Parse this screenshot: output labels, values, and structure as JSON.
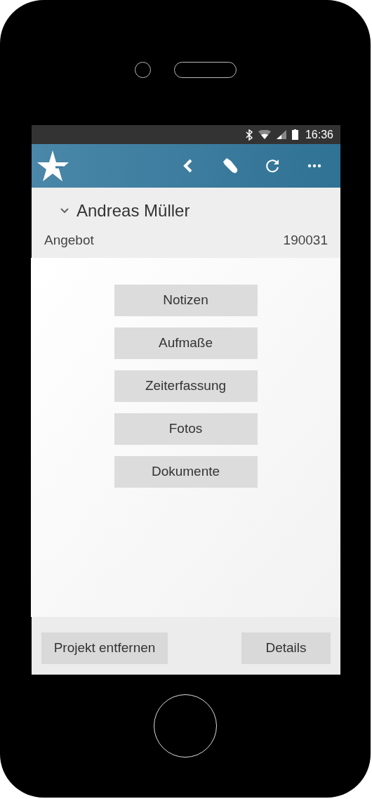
{
  "status_bar": {
    "time": "16:36"
  },
  "header": {
    "title": "Andreas Müller",
    "expanded": true,
    "type": "Angebot",
    "number": "190031"
  },
  "menu_buttons": [
    "Notizen",
    "Aufmaße",
    "Zeiterfassung",
    "Fotos",
    "Dokumente"
  ],
  "footer_buttons": [
    "Projekt entfernen",
    "Details"
  ]
}
